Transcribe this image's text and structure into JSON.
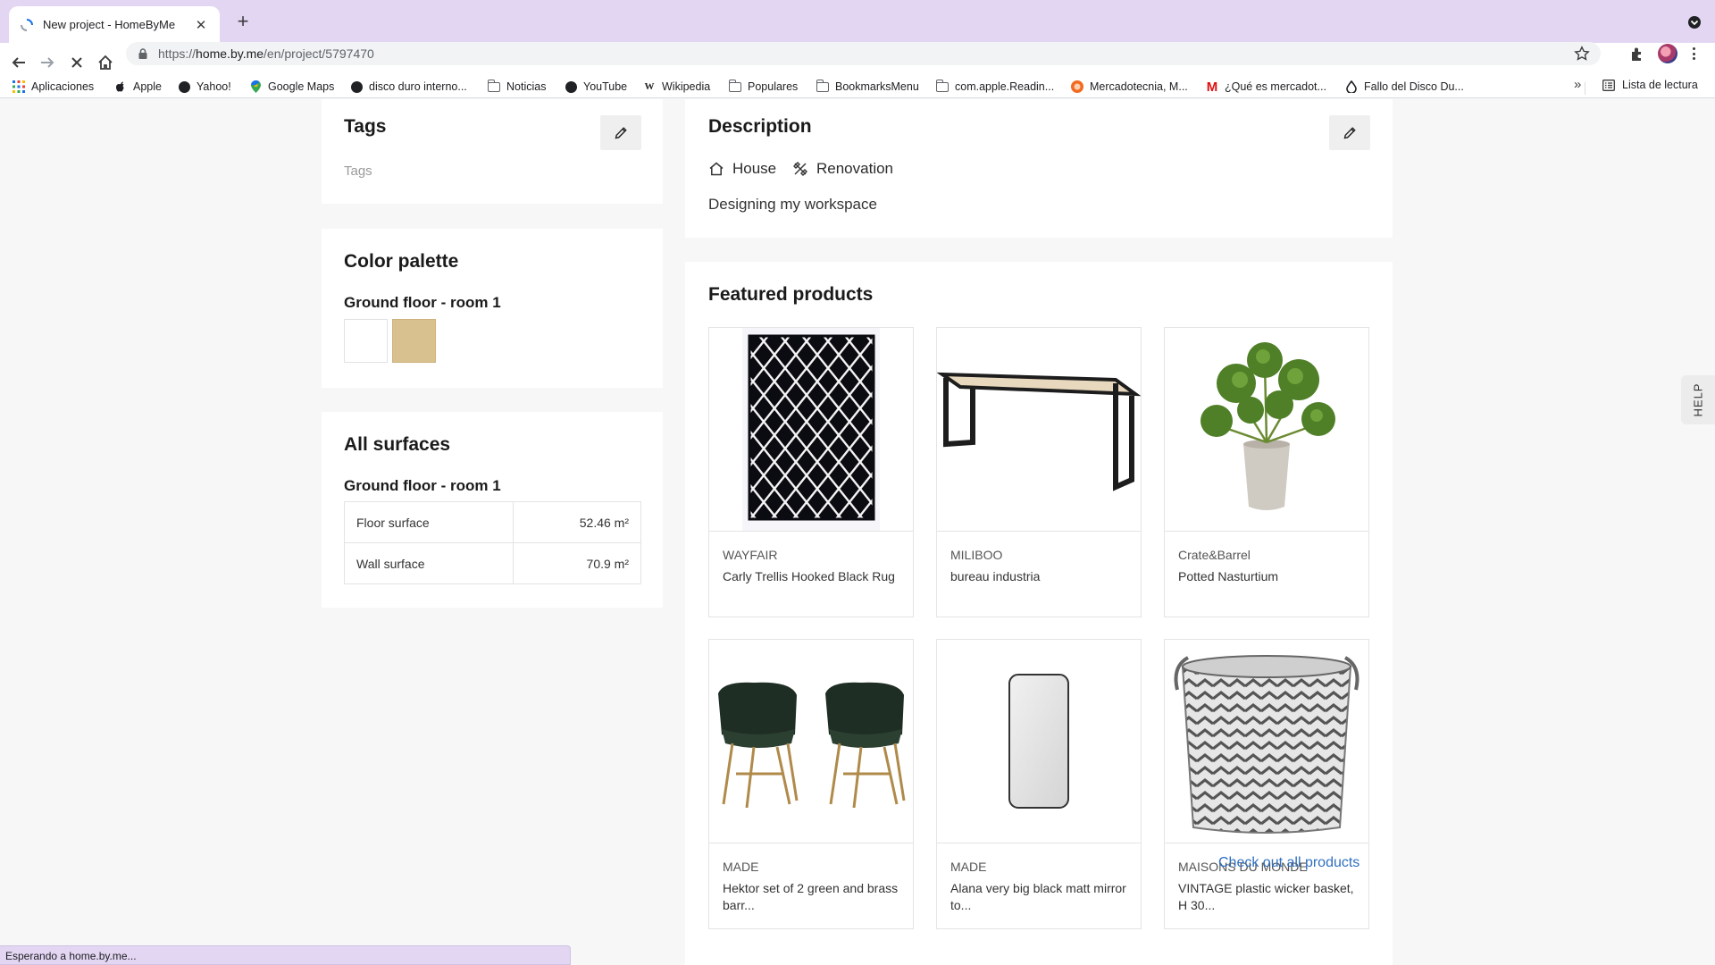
{
  "browser": {
    "tab_title": "New project - HomeByMe",
    "url_prefix": "https://",
    "url_host": "home.by.me",
    "url_path": "/en/project/5797470",
    "bookmarks": [
      {
        "label": "Aplicaciones",
        "icon": "apps-grid-icon"
      },
      {
        "label": "Apple",
        "icon": "apple-icon"
      },
      {
        "label": "Yahoo!",
        "icon": "globe-icon"
      },
      {
        "label": "Google Maps",
        "icon": "maps-pin-icon"
      },
      {
        "label": "disco duro interno...",
        "icon": "globe-icon"
      },
      {
        "label": "Noticias",
        "icon": "folder-icon"
      },
      {
        "label": "YouTube",
        "icon": "globe-icon"
      },
      {
        "label": "Wikipedia",
        "icon": "wikipedia-icon"
      },
      {
        "label": "Populares",
        "icon": "folder-icon"
      },
      {
        "label": "BookmarksMenu",
        "icon": "folder-icon"
      },
      {
        "label": "com.apple.Readin...",
        "icon": "folder-icon"
      },
      {
        "label": "Mercadotecnia, M...",
        "icon": "site-icon"
      },
      {
        "label": "¿Qué es mercadot...",
        "icon": "gmail-icon"
      },
      {
        "label": "Fallo del Disco Du...",
        "icon": "site-icon"
      }
    ],
    "reading_list": "Lista de lectura",
    "more_label": "»",
    "status_text": "Esperando a home.by.me..."
  },
  "tags": {
    "title": "Tags",
    "placeholder": "Tags"
  },
  "palette": {
    "title": "Color palette",
    "room": "Ground floor - room 1",
    "colors": [
      "#ffffff",
      "#d9c08f"
    ]
  },
  "surfaces": {
    "title": "All surfaces",
    "room": "Ground floor - room 1",
    "rows": [
      {
        "label": "Floor surface",
        "value": "52.46 m²"
      },
      {
        "label": "Wall surface",
        "value": "70.9 m²"
      }
    ]
  },
  "description": {
    "title": "Description",
    "chips": [
      {
        "label": "House",
        "icon": "house-icon"
      },
      {
        "label": "Renovation",
        "icon": "renovation-tools-icon"
      }
    ],
    "text": "Designing my workspace"
  },
  "featured": {
    "title": "Featured products",
    "products": [
      {
        "brand": "WAYFAIR",
        "name": "Carly Trellis Hooked Black Rug"
      },
      {
        "brand": "MILIBOO",
        "name": "bureau industria"
      },
      {
        "brand": "Crate&Barrel",
        "name": "Potted Nasturtium"
      },
      {
        "brand": "MADE",
        "name": "Hektor set of 2 green and brass barr..."
      },
      {
        "brand": "MADE",
        "name": "Alana very big black matt mirror to..."
      },
      {
        "brand": "MAISONS DU MONDE",
        "name": "VINTAGE plastic wicker basket, H 30..."
      }
    ],
    "cta": "Check out all products"
  },
  "help_label": "HELP"
}
